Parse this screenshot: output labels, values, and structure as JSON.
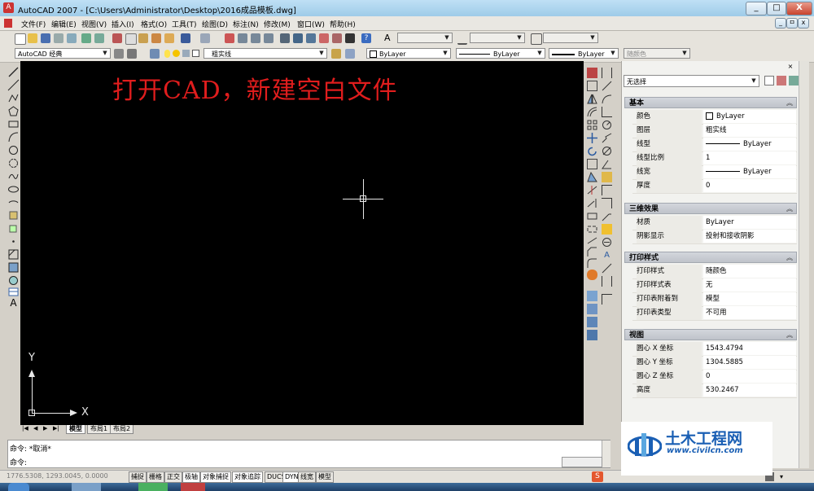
{
  "window": {
    "title": "AutoCAD 2007 - [C:\\Users\\Administrator\\Desktop\\2016成品模板.dwg]",
    "buttons": [
      "_",
      "□",
      "X"
    ],
    "doc_buttons": [
      "_",
      "ㅁ",
      "x"
    ]
  },
  "menu": {
    "items": [
      "文件(F)",
      "编辑(E)",
      "视图(V)",
      "插入(I)",
      "格式(O)",
      "工具(T)",
      "绘图(D)",
      "标注(N)",
      "修改(M)",
      "窗口(W)",
      "帮助(H)"
    ]
  },
  "toolbar2": {
    "workspace": "AutoCAD 经典",
    "layer": "粗实线",
    "color": "ByLayer",
    "linetype": "ByLayer",
    "lineweight": "ByLayer",
    "plotstyle": "随颜色"
  },
  "canvas": {
    "annotation": "打开CAD，新建空白文件",
    "ucs_x": "X",
    "ucs_y": "Y"
  },
  "layout_tabs": [
    "模型",
    "布局1",
    "布局2"
  ],
  "tab_nav": [
    "|◀",
    "◀",
    "▶",
    "▶|"
  ],
  "properties": {
    "selection": "无选择",
    "sections": [
      {
        "title": "基本",
        "rows": [
          {
            "k": "颜色",
            "v": "ByLayer",
            "swatch": true
          },
          {
            "k": "图层",
            "v": "粗实线"
          },
          {
            "k": "线型",
            "v": "ByLayer",
            "line": true
          },
          {
            "k": "线型比例",
            "v": "1"
          },
          {
            "k": "线宽",
            "v": "ByLayer",
            "line": true
          },
          {
            "k": "厚度",
            "v": "0"
          }
        ]
      },
      {
        "title": "三维效果",
        "rows": [
          {
            "k": "材质",
            "v": "ByLayer"
          },
          {
            "k": "阴影显示",
            "v": "投射和接收阴影"
          }
        ]
      },
      {
        "title": "打印样式",
        "rows": [
          {
            "k": "打印样式",
            "v": "随颜色"
          },
          {
            "k": "打印样式表",
            "v": "无"
          },
          {
            "k": "打印表附着到",
            "v": "模型"
          },
          {
            "k": "打印表类型",
            "v": "不可用"
          }
        ]
      },
      {
        "title": "视图",
        "rows": [
          {
            "k": "圆心 X 坐标",
            "v": "1543.4794"
          },
          {
            "k": "圆心 Y 坐标",
            "v": "1304.5885"
          },
          {
            "k": "圆心 Z 坐标",
            "v": "0"
          },
          {
            "k": "高度",
            "v": "530.2467"
          }
        ]
      }
    ]
  },
  "command": {
    "line1": "命令: *取消*",
    "line2": "命令:"
  },
  "status": {
    "coords": "1776.5308, 1293.0045, 0.0000",
    "buttons": [
      "捕捉",
      "栅格",
      "正交",
      "极轴",
      "对象捕捉",
      "对象追踪",
      "DUCS",
      "DYN",
      "线宽",
      "模型"
    ]
  },
  "watermark": {
    "brand": "土木工程网",
    "url": "www.civilcn.com"
  },
  "colors": {
    "canvas_bg": "#000000",
    "annotation": "#e01d1d",
    "watermark_blue": "#1a5fb4"
  }
}
